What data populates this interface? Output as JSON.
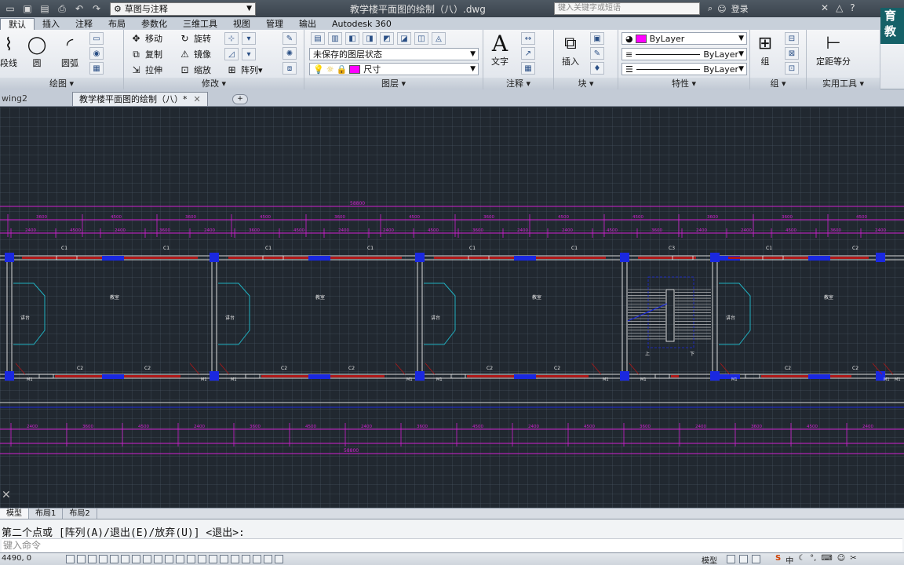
{
  "titlebar": {
    "workspace": "草图与注释",
    "doc_title": "教学楼平面图的绘制（八）.dwg",
    "search_placeholder": "键入关键字或短语",
    "login": "登录",
    "corner_logo_line1": "育",
    "corner_logo_line2": "教"
  },
  "ribbon_tabs": [
    "默认",
    "插入",
    "注释",
    "布局",
    "参数化",
    "三维工具",
    "视图",
    "管理",
    "输出",
    "Autodesk 360"
  ],
  "panels": {
    "draw": {
      "title": "绘图",
      "polyline": "段线",
      "circle": "圆",
      "arc": "圆弧"
    },
    "modify": {
      "title": "修改",
      "move": "移动",
      "rotate": "旋转",
      "copy": "复制",
      "mirror": "镜像",
      "stretch": "拉伸",
      "scale": "缩放",
      "array": "阵列"
    },
    "layers": {
      "title": "图层",
      "layer_state": "未保存的图层状态",
      "current_layer": "尺寸"
    },
    "annotation": {
      "title": "注释",
      "text": "文字"
    },
    "block": {
      "title": "块",
      "insert": "插入"
    },
    "properties": {
      "title": "特性",
      "color": "ByLayer",
      "linetype": "ByLayer",
      "lineweight": "ByLayer"
    },
    "groups": {
      "title": "组",
      "group": "组"
    },
    "utilities": {
      "title": "实用工具",
      "measure": "定距等分"
    }
  },
  "doc_tabs": [
    {
      "label": "wing2"
    },
    {
      "label": "教学楼平面图的绘制（八）*"
    }
  ],
  "drawing": {
    "top_dims_row1": [
      "3600",
      "4500",
      "3600",
      "4500",
      "3600",
      "4500",
      "3600",
      "4500",
      "4500",
      "3600",
      "3600",
      "4500"
    ],
    "top_dims_row2": [
      "2400",
      "4500",
      "2400",
      "3600",
      "2400",
      "3600",
      "4500",
      "2400",
      "2400",
      "4500",
      "3600",
      "2400",
      "2400",
      "4500",
      "3600",
      "2400",
      "2400",
      "4500",
      "3600",
      "2400"
    ],
    "overall_dim": "58800",
    "windows_top": [
      "C1",
      "C1",
      "C1",
      "C1",
      "C1",
      "C1",
      "C3",
      "C1",
      "C2"
    ],
    "windows_bottom": [
      "C2",
      "C2",
      "C2",
      "C2",
      "C2",
      "C2",
      "C2",
      "C2"
    ],
    "doors": [
      "M1",
      "M1",
      "M1",
      "M1",
      "M1",
      "M1",
      "M1",
      "M1",
      "M1",
      "M1"
    ],
    "room_labels": [
      "教室",
      "教室",
      "教室",
      "教室"
    ],
    "small_room_labels": [
      "讲台",
      "讲台",
      "讲台",
      "讲台"
    ],
    "stair_up": "上",
    "stair_down": "下",
    "bottom_dims": [
      "2400",
      "3600",
      "4500",
      "2400",
      "3600",
      "4500",
      "2400",
      "3600",
      "4500",
      "2400",
      "4500",
      "3600",
      "2400",
      "3600",
      "4500",
      "2400"
    ],
    "bottom_overall": "58800"
  },
  "layout_tabs": [
    "模型",
    "布局1",
    "布局2"
  ],
  "command": {
    "history": "第二个点或 [阵列(A)/退出(E)/放弃(U)] <退出>:",
    "input_placeholder": "键入命令"
  },
  "status": {
    "coords": "4490, 0",
    "model": "模型",
    "ime": "中"
  }
}
